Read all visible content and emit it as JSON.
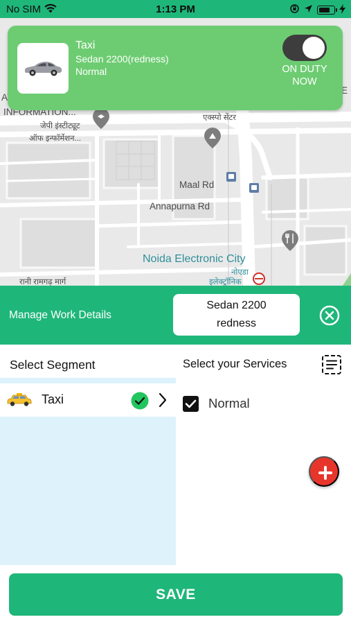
{
  "status_bar": {
    "carrier": "No SIM",
    "time": "1:13 PM"
  },
  "map": {
    "labels": {
      "information": "INFORMATION...",
      "hindi_institute_1": "जेपी इंस्टीट्यूट",
      "hindi_institute_2": "ऑफ इन्फॉर्मेशन...",
      "hindi_expo": "एक्स्पो सेंटर",
      "maal_rd": "Maal Rd",
      "annapurna_rd": "Annapurna Rd",
      "noida_electronic_city": "Noida Electronic City",
      "hindi_noida_1": "नोएडा",
      "hindi_noida_2": "इलेक्ट्रॉनिक",
      "hindi_rani": "रानी रामगढ़ मार्ग",
      "edge_left": "AY",
      "edge_right": "E"
    }
  },
  "vehicle_card": {
    "title": "Taxi",
    "model": "Sedan 2200(redness)",
    "service": "Normal",
    "duty_line1": "ON DUTY",
    "duty_line2": "NOW",
    "duty_on": true
  },
  "manage": {
    "title": "Manage Work Details",
    "vehicle_line1": "Sedan 2200",
    "vehicle_line2": "redness"
  },
  "segment": {
    "title": "Select Segment",
    "items": [
      {
        "label": "Taxi",
        "selected": true
      }
    ]
  },
  "services": {
    "title": "Select your Services",
    "items": [
      {
        "label": "Normal",
        "checked": true
      }
    ]
  },
  "save_label": "SAVE",
  "colors": {
    "primary": "#1fb67a",
    "card": "#6dcc72",
    "segment_bg": "#ddf2fb",
    "add_button": "#e8352b",
    "check": "#22c55e"
  }
}
